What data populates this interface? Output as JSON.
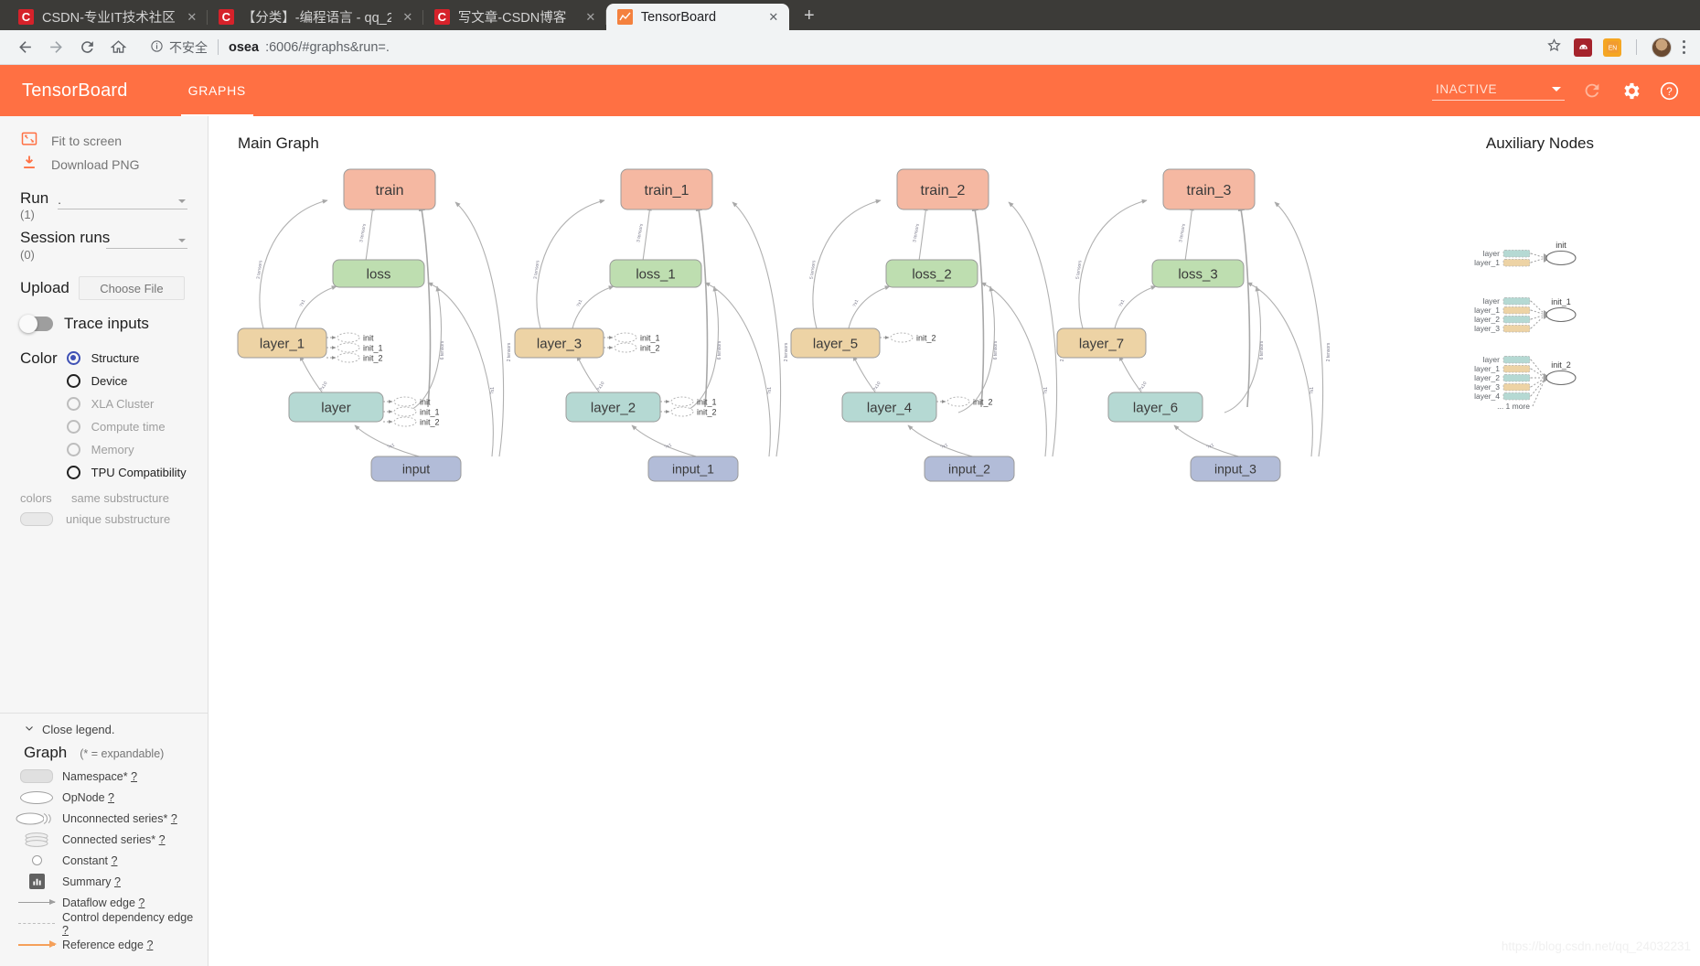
{
  "browser": {
    "tabs": [
      {
        "title": "CSDN-专业IT技术社区",
        "favicon": "csdn-icon",
        "active": false,
        "close": "✕"
      },
      {
        "title": "【分类】-编程语言 - qq_2",
        "favicon": "csdn-icon",
        "active": false,
        "close": "✕"
      },
      {
        "title": "写文章-CSDN博客",
        "favicon": "csdn-icon",
        "active": false,
        "close": "✕"
      },
      {
        "title": "TensorBoard",
        "favicon": "tensorboard-icon",
        "active": true,
        "close": "✕"
      }
    ],
    "new_tab_label": "+",
    "nav": {
      "back": "back-arrow-icon",
      "forward": "forward-arrow-icon",
      "reload": "reload-icon",
      "home": "home-icon"
    },
    "omnibox": {
      "security_icon": "info-circle-icon",
      "security_text": "不安全",
      "url_host": "osea",
      "url_rest": ":6006/#graphs&run=.",
      "star_icon": "star-icon",
      "ext_1": "extension-icon",
      "ext_2": "translate-icon",
      "avatar": "profile-avatar",
      "menu": "kebab-menu-icon"
    }
  },
  "header": {
    "brand": "TensorBoard",
    "tabs": [
      {
        "label": "GRAPHS",
        "active": true
      }
    ],
    "reload_state": "INACTIVE",
    "icons": [
      "refresh-icon",
      "settings-gear-icon",
      "help-question-icon"
    ]
  },
  "sidebar": {
    "fit_to_screen": "Fit to screen",
    "download_png": "Download PNG",
    "run": {
      "label": "Run",
      "count": "(1)",
      "value": "."
    },
    "session_runs": {
      "label": "Session runs",
      "count": "(0)",
      "value": ""
    },
    "upload": {
      "label": "Upload",
      "button": "Choose File"
    },
    "trace_inputs": {
      "label": "Trace inputs",
      "on": false
    },
    "color": {
      "label": "Color",
      "options": [
        {
          "label": "Structure",
          "selected": true,
          "enabled": true
        },
        {
          "label": "Device",
          "selected": false,
          "enabled": true
        },
        {
          "label": "XLA Cluster",
          "selected": false,
          "enabled": false
        },
        {
          "label": "Compute time",
          "selected": false,
          "enabled": false
        },
        {
          "label": "Memory",
          "selected": false,
          "enabled": false
        },
        {
          "label": "TPU Compatibility",
          "selected": false,
          "enabled": true
        }
      ]
    },
    "colors_legend": {
      "key": "colors",
      "same": "same substructure",
      "unique": "unique substructure"
    },
    "legend": {
      "close": "Close legend.",
      "title": "Graph",
      "expandable_note": "(* = expandable)",
      "items": [
        {
          "glyph": "namespace-glyph",
          "label": "Namespace*",
          "help": "?"
        },
        {
          "glyph": "opnode-glyph",
          "label": "OpNode",
          "help": "?"
        },
        {
          "glyph": "unconnected-series-glyph",
          "label": "Unconnected series*",
          "help": "?"
        },
        {
          "glyph": "connected-series-glyph",
          "label": "Connected series*",
          "help": "?"
        },
        {
          "glyph": "constant-glyph",
          "label": "Constant",
          "help": "?"
        },
        {
          "glyph": "summary-glyph",
          "label": "Summary",
          "help": "?"
        },
        {
          "glyph": "dataflow-edge-glyph",
          "label": "Dataflow edge",
          "help": "?"
        },
        {
          "glyph": "control-dependency-edge-glyph",
          "label": "Control dependency edge",
          "help": "?"
        },
        {
          "glyph": "reference-edge-glyph",
          "label": "Reference edge",
          "help": "?"
        }
      ]
    }
  },
  "canvas": {
    "main_graph_title": "Main Graph",
    "aux_title": "Auxiliary Nodes",
    "watermark": "https://blog.csdn.net/qq_24032231",
    "colors": {
      "train": "#f5b8a2",
      "loss": "#bedeb0",
      "layer_odd": "#edd3a5",
      "layer_even": "#b5d9d3",
      "input": "#b2bcd8",
      "stroke": "#9a9a9a",
      "edge": "#b0b0b0"
    },
    "clusters": [
      {
        "train": "train",
        "loss": "loss",
        "upper_layer": "layer_1",
        "lower_layer": "layer",
        "input": "input",
        "upper_inits": [
          "init",
          "init_1",
          "init_2"
        ],
        "lower_inits": [
          "init",
          "init_1",
          "init_2"
        ],
        "edge_labels": [
          "3 tensors",
          "3 tensors",
          "6 tensors",
          "2 tensors",
          "?x1",
          "?x1",
          "?x10",
          "?x1"
        ]
      },
      {
        "train": "train_1",
        "loss": "loss_1",
        "upper_layer": "layer_3",
        "lower_layer": "layer_2",
        "input": "input_1",
        "upper_inits": [
          "init_1",
          "init_2"
        ],
        "lower_inits": [
          "init_1",
          "init_2"
        ],
        "edge_labels": [
          "3 tensors",
          "3 tensors",
          "6 tensors",
          "2 tensors",
          "?x1",
          "?x1",
          "?x10",
          "?x1"
        ]
      },
      {
        "train": "train_2",
        "loss": "loss_2",
        "upper_layer": "layer_5",
        "lower_layer": "layer_4",
        "input": "input_2",
        "upper_inits": [
          "init_2"
        ],
        "lower_inits": [
          "init_2"
        ],
        "edge_labels": [
          "5 tensors",
          "3 tensors",
          "6 tensors",
          "2 tensors",
          "?x1",
          "?x1",
          "?x10",
          "?x1"
        ]
      },
      {
        "train": "train_3",
        "loss": "loss_3",
        "upper_layer": "layer_7",
        "lower_layer": "layer_6",
        "input": "input_3",
        "upper_inits": [],
        "lower_inits": [],
        "edge_labels": [
          "5 tensors",
          "3 tensors",
          "6 tensors",
          "2 tensors",
          "?x1",
          "?x1",
          "?x10",
          "?x1"
        ]
      }
    ],
    "aux_groups": [
      {
        "op": "init",
        "sources": [
          "layer",
          "layer_1"
        ],
        "more": null
      },
      {
        "op": "init_1",
        "sources": [
          "layer",
          "layer_1",
          "layer_2",
          "layer_3"
        ],
        "more": null
      },
      {
        "op": "init_2",
        "sources": [
          "layer",
          "layer_1",
          "layer_2",
          "layer_3",
          "layer_4"
        ],
        "more": "... 1 more"
      }
    ]
  }
}
